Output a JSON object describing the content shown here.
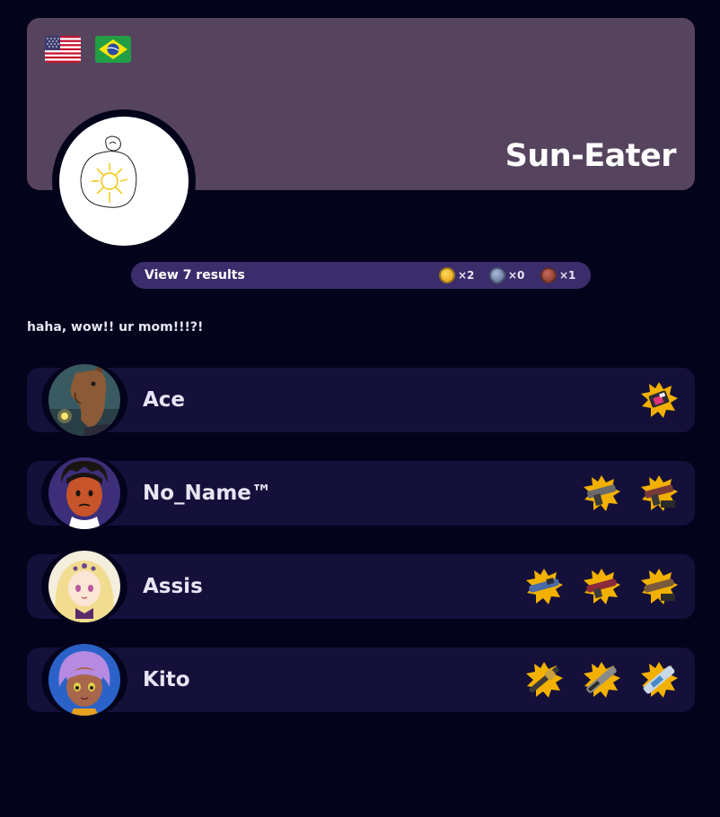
{
  "team": {
    "name": "Sun-Eater",
    "flags": [
      "us-flag",
      "brazil-flag"
    ],
    "header_color": "#56445f"
  },
  "results": {
    "link_label": "View 7 results",
    "medals": {
      "gold": "×2",
      "silver": "×0",
      "bronze": "×1"
    }
  },
  "bio": "haha, wow!! ur mom!!!?!",
  "players": [
    {
      "name": "Ace",
      "avatar": "horse-character-avatar",
      "weapons": [
        "splatter-weapon-icon"
      ]
    },
    {
      "name": "No_Name™",
      "avatar": "mii-avatar",
      "weapons": [
        "splatter-weapon-icon",
        "splatter-weapon-icon"
      ]
    },
    {
      "name": "Assis",
      "avatar": "anime-girl-avatar",
      "weapons": [
        "splatter-weapon-icon",
        "splatter-weapon-icon",
        "splatter-weapon-icon"
      ]
    },
    {
      "name": "Kito",
      "avatar": "octoling-avatar",
      "weapons": [
        "splatter-weapon-icon",
        "splatter-weapon-icon",
        "splatter-weapon-icon"
      ]
    }
  ],
  "colors": {
    "background": "#04031c",
    "row": "#15103a",
    "results_bar": "#3b2d6b",
    "text": "#e8e4f4"
  }
}
